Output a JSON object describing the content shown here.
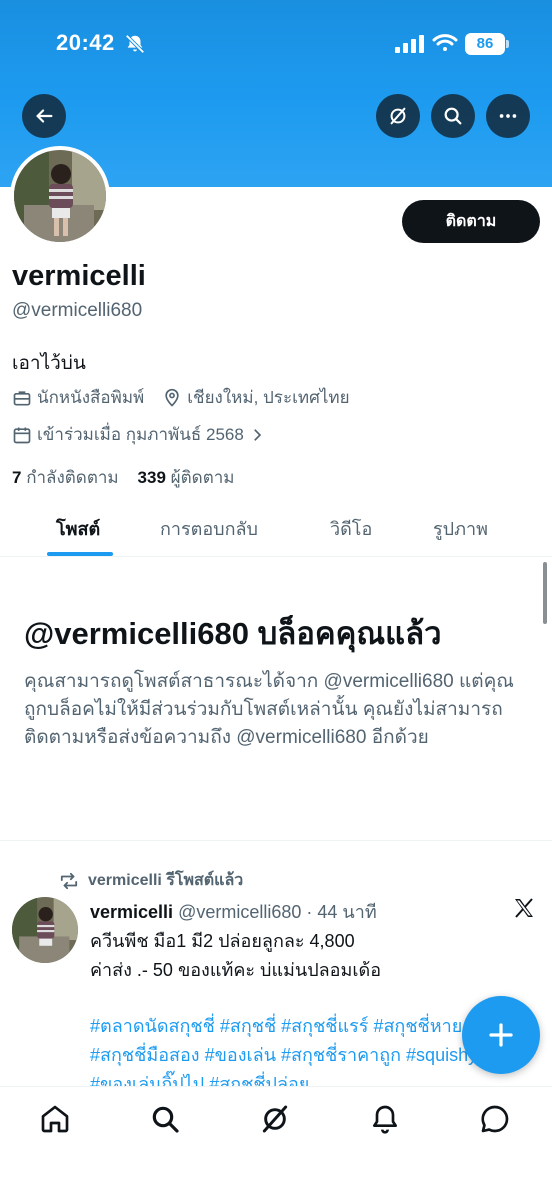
{
  "status_bar": {
    "time": "20:42",
    "battery": "86"
  },
  "header": {
    "back_icon": "arrow-left-icon",
    "grok_icon": "grok-icon",
    "search_icon": "search-icon",
    "more_icon": "more-icon"
  },
  "profile": {
    "follow_label": "ติดตาม",
    "display_name": "vermicelli",
    "handle": "@vermicelli680",
    "bio": "เอาไว้บ่น",
    "occupation": "นักหนังสือพิมพ์",
    "location": "เชียงใหม่, ประเทศไทย",
    "joined": "เข้าร่วมเมื่อ กุมภาพันธ์ 2568",
    "following_count": "7",
    "following_label": "กำลังติดตาม",
    "followers_count": "339",
    "followers_label": "ผู้ติดตาม"
  },
  "tabs": [
    {
      "label": "โพสต์",
      "active": true
    },
    {
      "label": "การตอบกลับ",
      "active": false
    },
    {
      "label": "วิดีโอ",
      "active": false
    },
    {
      "label": "รูปภาพ",
      "active": false
    }
  ],
  "blocked": {
    "title": "@vermicelli680 บล็อคคุณแล้ว",
    "message": "คุณสามารถดูโพสต์สาธารณะได้จาก @vermicelli680 แต่คุณถูกบล็อคไม่ให้มีส่วนร่วมกับโพสต์เหล่านั้น คุณยังไม่สามารถติดตามหรือส่งข้อความถึง @vermicelli680 อีกด้วย"
  },
  "post": {
    "repost_label": "vermicelli รีโพสต์แล้ว",
    "author_name": "vermicelli",
    "author_meta": "@vermicelli680 · 44 นาที",
    "line1": "ควีนพีช มือ1 มี2 ปล่อยลูกละ 4,800",
    "line2": "ค่าส่ง .- 50 ของแท้คะ บ่แม่นปลอมเด้อ",
    "hashtags": "#ตลาดนัดสกุชชี่ #สกุชชี่ #สกุชชี่แรร์ #สกุชชี่หายาก #สกุชชี่มือสอง #ของเล่น #สกุชชี่ราคาถูก #squishy #ของเล่นกิ๊ปไป #สกุชชี่ปล่อย"
  },
  "colors": {
    "accent": "#1d9bf0",
    "text": "#0f1419",
    "muted": "#536471"
  },
  "bottom_nav": [
    "home-icon",
    "search-icon",
    "grok-icon",
    "notifications-icon",
    "messages-icon"
  ]
}
